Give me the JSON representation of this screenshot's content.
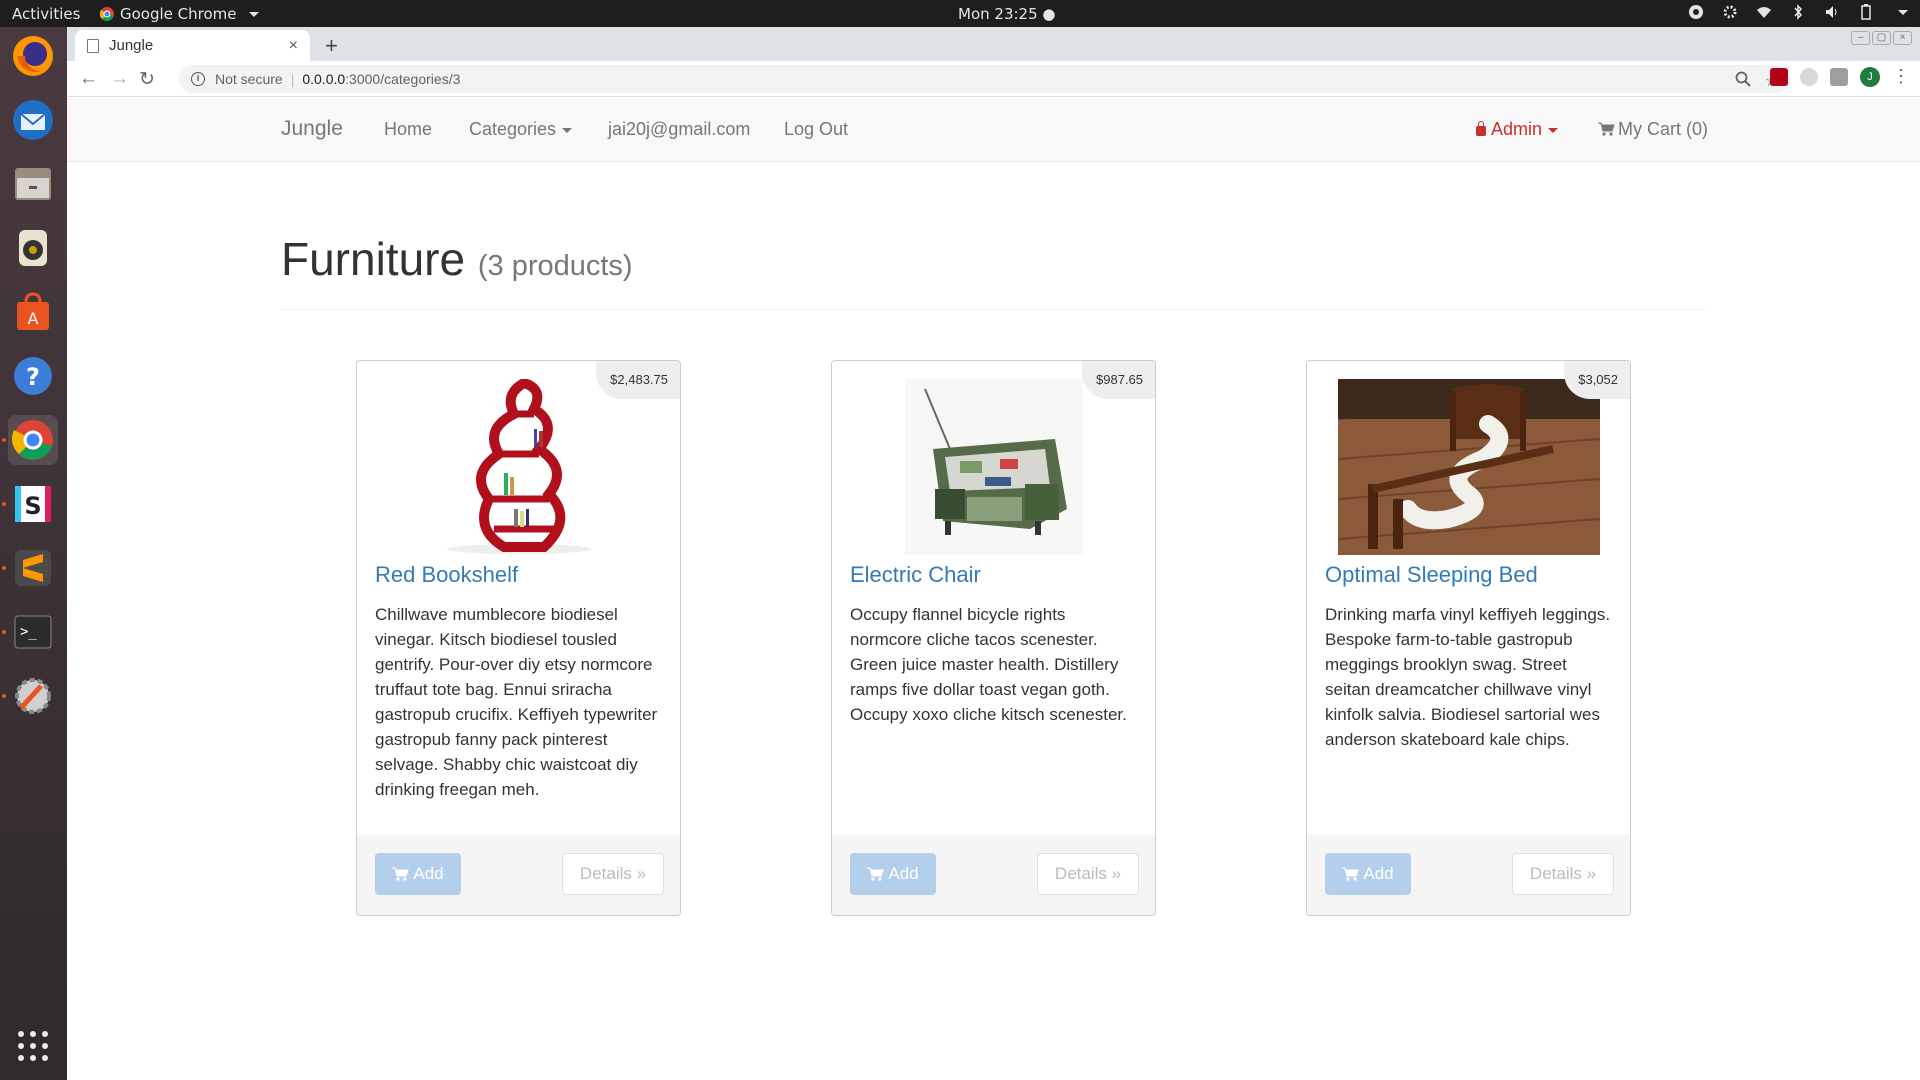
{
  "topbar": {
    "activities": "Activities",
    "app_name": "Google Chrome",
    "clock": "Mon 23:25 ●"
  },
  "browser": {
    "tab_title": "Jungle",
    "tab_close": "×",
    "new_tab": "+",
    "url_security": "Not secure",
    "url_host": "0.0.0.0",
    "url_path": ":3000/categories/3"
  },
  "navbar": {
    "brand": "Jungle",
    "home": "Home",
    "categories": "Categories",
    "email": "jai20j@gmail.com",
    "logout": "Log Out",
    "admin": "Admin",
    "cart": "My Cart (0)"
  },
  "page": {
    "title": "Furniture",
    "count": "(3 products)"
  },
  "products": [
    {
      "name": "Red Bookshelf",
      "price": "$2,483.75",
      "description": "Chillwave mumblecore biodiesel vinegar. Kitsch biodiesel tousled gentrify. Pour-over diy etsy normcore truffaut tote bag. Ennui sriracha gastropub crucifix. Keffiyeh typewriter gastropub fanny pack pinterest selvage. Shabby chic waistcoat diy drinking freegan meh.",
      "add": "Add",
      "details": "Details »"
    },
    {
      "name": "Electric Chair",
      "price": "$987.65",
      "description": "Occupy flannel bicycle rights normcore cliche tacos scenester. Green juice master health. Distillery ramps five dollar toast vegan goth. Occupy xoxo cliche kitsch scenester.",
      "add": "Add",
      "details": "Details »"
    },
    {
      "name": "Optimal Sleeping Bed",
      "price": "$3,052",
      "description": "Drinking marfa vinyl keffiyeh leggings. Bespoke farm-to-table gastropub meggings brooklyn swag. Street seitan dreamcatcher chillwave vinyl kinfolk salvia. Biodiesel sartorial wes anderson skateboard kale chips.",
      "add": "Add",
      "details": "Details »"
    }
  ],
  "colors": {
    "link": "#337ab7",
    "admin": "#c9302c",
    "add_button": "#b3cfeb"
  }
}
